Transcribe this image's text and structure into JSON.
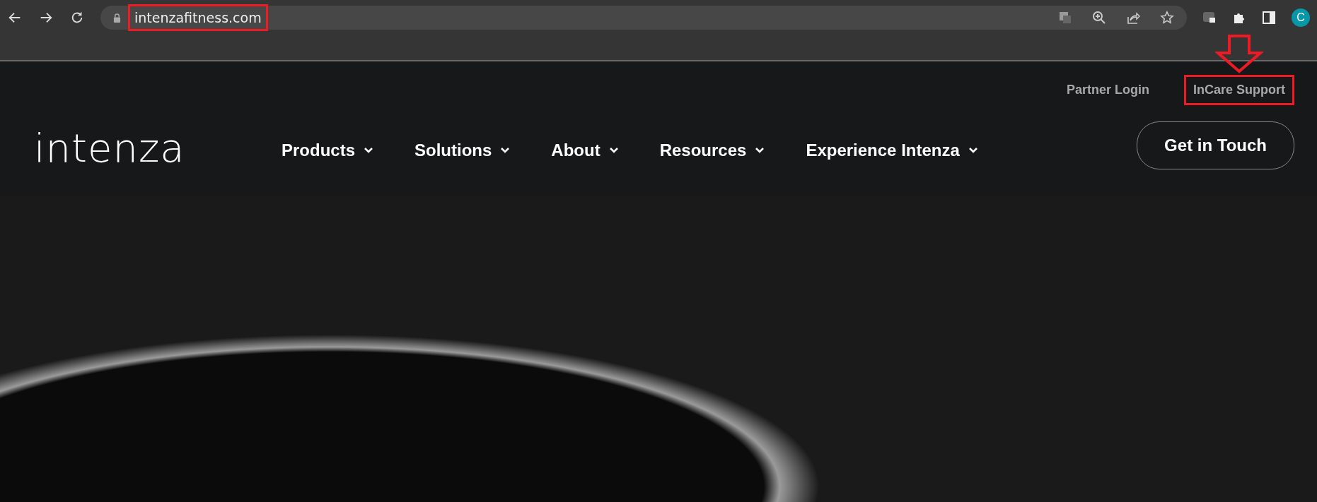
{
  "browser": {
    "url": "intenzafitness.com",
    "url_highlighted": true,
    "profile_initial": "C"
  },
  "header": {
    "logo": "intenza",
    "top_links": [
      {
        "label": "Partner Login",
        "highlighted": false
      },
      {
        "label": "InCare Support",
        "highlighted": true
      }
    ],
    "nav": [
      {
        "label": "Products"
      },
      {
        "label": "Solutions"
      },
      {
        "label": "About"
      },
      {
        "label": "Resources"
      },
      {
        "label": "Experience Intenza"
      }
    ],
    "cta": "Get in Touch"
  }
}
